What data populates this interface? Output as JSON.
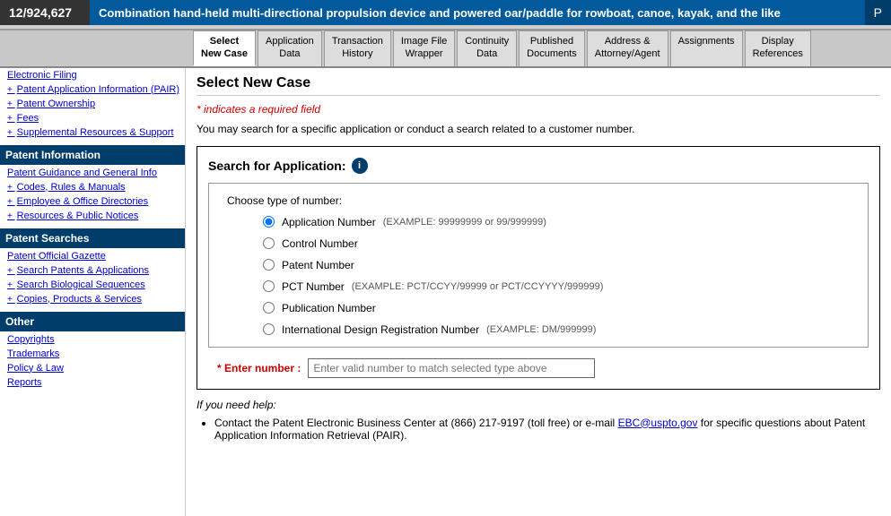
{
  "topBar": {
    "caseNumber": "12/924,627",
    "caseTitle": "Combination hand-held multi-directional propulsion device and powered oar/paddle for rowboat, canoe, kayak, and the like",
    "iconLabel": "P"
  },
  "tabs": [
    {
      "id": "select-new-case",
      "label": "Select\nNew Case",
      "active": true
    },
    {
      "id": "application-data",
      "label": "Application\nData",
      "active": false
    },
    {
      "id": "transaction-history",
      "label": "Transaction\nHistory",
      "active": false
    },
    {
      "id": "image-file-wrapper",
      "label": "Image File\nWrapper",
      "active": false
    },
    {
      "id": "continuity-data",
      "label": "Continuity\nData",
      "active": false
    },
    {
      "id": "published-documents",
      "label": "Published\nDocuments",
      "active": false
    },
    {
      "id": "address-attorney",
      "label": "Address &\nAttorney/Agent",
      "active": false
    },
    {
      "id": "assignments",
      "label": "Assignments",
      "active": false
    },
    {
      "id": "display-references",
      "label": "Display\nReferences",
      "active": false
    }
  ],
  "sidebar": {
    "sections": [
      {
        "id": "main-nav",
        "header": null,
        "items": [
          {
            "id": "electronic-filing",
            "label": "Electronic Filing",
            "plus": false
          },
          {
            "id": "patent-application-info",
            "label": "Patent Application Information\n(PAIR)",
            "plus": true
          },
          {
            "id": "patent-ownership",
            "label": "Patent Ownership",
            "plus": true
          },
          {
            "id": "fees",
            "label": "Fees",
            "plus": true
          },
          {
            "id": "supplemental-resources",
            "label": "Supplemental Resources & Support",
            "plus": true
          }
        ]
      },
      {
        "id": "patent-information",
        "header": "Patent Information",
        "items": [
          {
            "id": "patent-guidance",
            "label": "Patent Guidance and General Info",
            "plus": false
          },
          {
            "id": "codes-rules",
            "label": "Codes, Rules & Manuals",
            "plus": true
          },
          {
            "id": "employee-directories",
            "label": "Employee & Office Directories",
            "plus": true
          },
          {
            "id": "resources-notices",
            "label": "Resources & Public Notices",
            "plus": true
          }
        ]
      },
      {
        "id": "patent-searches",
        "header": "Patent Searches",
        "items": [
          {
            "id": "patent-gazette",
            "label": "Patent Official Gazette",
            "plus": false
          },
          {
            "id": "search-patents",
            "label": "Search Patents & Applications",
            "plus": true
          },
          {
            "id": "search-biological",
            "label": "Search Biological Sequences",
            "plus": true
          },
          {
            "id": "copies-products",
            "label": "Copies, Products & Services",
            "plus": true
          }
        ]
      },
      {
        "id": "other",
        "header": "Other",
        "items": [
          {
            "id": "copyrights",
            "label": "Copyrights",
            "plus": false
          },
          {
            "id": "trademarks",
            "label": "Trademarks",
            "plus": false
          },
          {
            "id": "policy-law",
            "label": "Policy & Law",
            "plus": false
          },
          {
            "id": "reports",
            "label": "Reports",
            "plus": false
          }
        ]
      }
    ]
  },
  "content": {
    "pageTitle": "Select New Case",
    "requiredNote": "* indicates a required field",
    "infoText": "You may search for a specific application or conduct a search related to a customer number.",
    "searchSection": {
      "title": "Search for Application:",
      "chooseTypeLabel": "Choose type of number:",
      "radioOptions": [
        {
          "id": "application-number",
          "label": "Application Number",
          "example": "(EXAMPLE: 99999999 or 99/999999)",
          "checked": true
        },
        {
          "id": "control-number",
          "label": "Control Number",
          "example": "",
          "checked": false
        },
        {
          "id": "patent-number",
          "label": "Patent Number",
          "example": "",
          "checked": false
        },
        {
          "id": "pct-number",
          "label": "PCT Number",
          "example": "(EXAMPLE: PCT/CCYY/99999 or PCT/CCYYYY/999999)",
          "checked": false
        },
        {
          "id": "publication-number",
          "label": "Publication Number",
          "example": "",
          "checked": false
        },
        {
          "id": "international-design",
          "label": "International Design Registration Number",
          "example": "(EXAMPLE: DM/999999)",
          "checked": false
        }
      ],
      "enterNumberLabel": "* Enter number :",
      "enterNumberPlaceholder": "Enter valid number to match selected type above"
    },
    "helpSection": {
      "title": "If you need help:",
      "items": [
        {
          "text": "Contact the Patent Electronic Business Center at (866) 217-9197 (toll free) or e-mail ",
          "linkText": "EBC@uspto.gov",
          "linkHref": "mailto:EBC@uspto.gov",
          "afterLink": " for specific questions about Patent Application Information Retrieval (PAIR)."
        }
      ]
    }
  }
}
